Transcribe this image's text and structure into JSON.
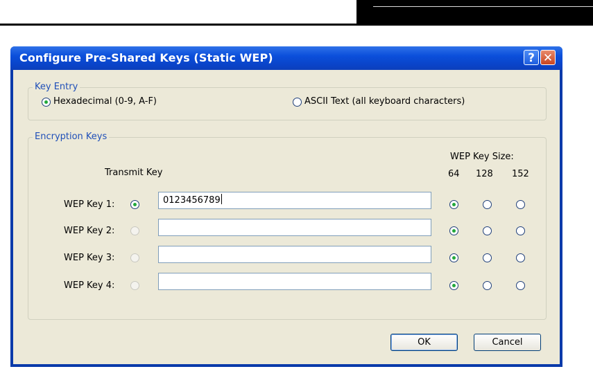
{
  "window": {
    "title": "Configure Pre-Shared Keys (Static WEP)",
    "help_label": "?",
    "close_label": "✕"
  },
  "key_entry": {
    "legend": "Key Entry",
    "options": [
      {
        "label": "Hexadecimal (0-9, A-F)",
        "checked": true
      },
      {
        "label": "ASCII Text (all keyboard characters)",
        "checked": false
      }
    ]
  },
  "encryption_keys": {
    "legend": "Encryption Keys",
    "transmit_key_header": "Transmit Key",
    "wep_key_size_header": "WEP Key Size:",
    "size_columns": [
      "64",
      "128",
      "152"
    ],
    "keys": [
      {
        "label": "WEP Key 1:",
        "value": "0123456789",
        "transmit_selected": true,
        "size": "64"
      },
      {
        "label": "WEP Key 2:",
        "value": "",
        "transmit_selected": false,
        "size": "64"
      },
      {
        "label": "WEP Key 3:",
        "value": "",
        "transmit_selected": false,
        "size": "64"
      },
      {
        "label": "WEP Key 4:",
        "value": "",
        "transmit_selected": false,
        "size": "64"
      }
    ]
  },
  "buttons": {
    "ok": "OK",
    "cancel": "Cancel"
  }
}
